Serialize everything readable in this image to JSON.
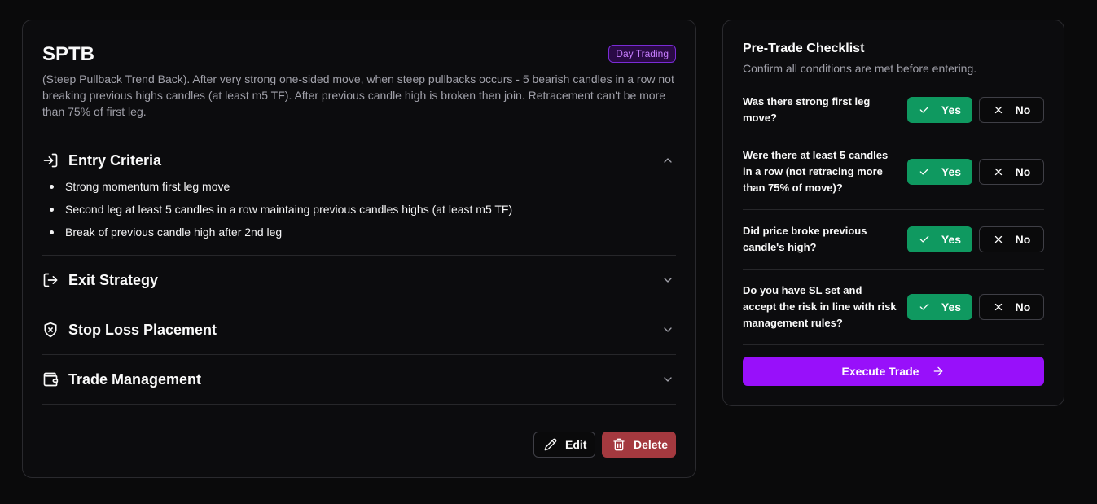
{
  "strategy": {
    "title": "SPTB",
    "badge": "Day Trading",
    "description": "(Steep Pullback Trend Back). After very strong one-sided move, when steep pullbacks occurs - 5 bearish candles in a row not breaking previous highs candles (at least m5 TF). After previous candle high is broken then join. Retracement can't be more than 75% of first leg.",
    "sections": [
      {
        "title": "Entry Criteria",
        "icon": "login-arrow-icon",
        "expanded": true,
        "items": [
          "Strong momentum first leg move",
          "Second leg at least 5 candles in a row maintaing previous candles highs (at least m5 TF)",
          "Break of previous candle high after 2nd leg"
        ]
      },
      {
        "title": "Exit Strategy",
        "icon": "logout-arrow-icon",
        "expanded": false
      },
      {
        "title": "Stop Loss Placement",
        "icon": "shield-x-icon",
        "expanded": false
      },
      {
        "title": "Trade Management",
        "icon": "wallet-icon",
        "expanded": false
      }
    ],
    "actions": {
      "edit_label": "Edit",
      "delete_label": "Delete"
    }
  },
  "checklist": {
    "title": "Pre-Trade Checklist",
    "subtitle": "Confirm all conditions are met before entering.",
    "yes_label": "Yes",
    "no_label": "No",
    "questions": [
      {
        "text": "Was there strong first leg move?",
        "answer": "Yes"
      },
      {
        "text": "Were there at least 5 candles in a row (not retracing more than 75% of move)?",
        "answer": "Yes"
      },
      {
        "text": "Did price broke previous candle's high?",
        "answer": "Yes"
      },
      {
        "text": "Do you have SL set and accept the risk in line with risk management rules?",
        "answer": "Yes"
      }
    ],
    "execute_label": "Execute Trade"
  },
  "colors": {
    "accent_purple": "#9810fa",
    "yes_green": "#0f9960",
    "delete_red": "#a4393f",
    "badge_text": "#c77dff"
  }
}
